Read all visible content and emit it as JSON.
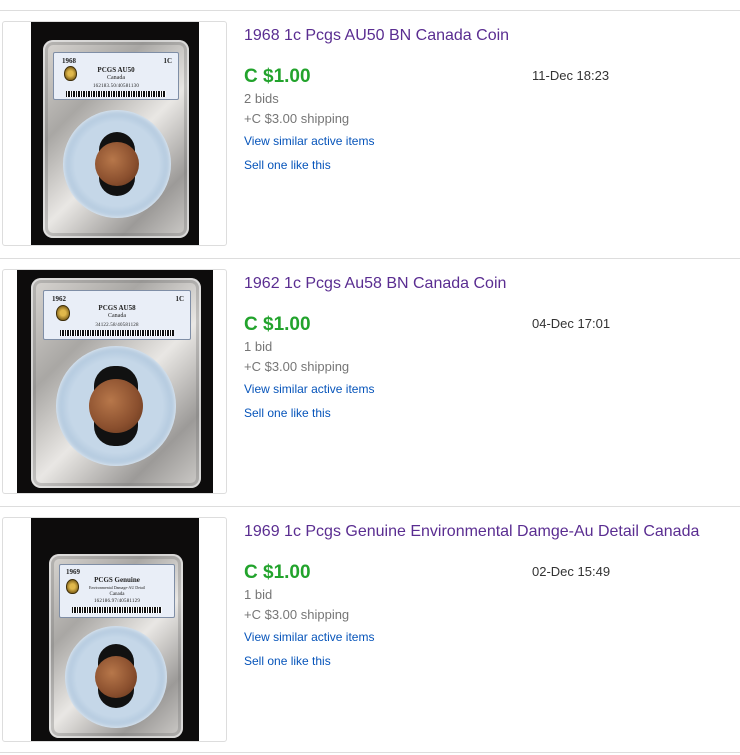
{
  "listings": [
    {
      "title": "1968 1c Pcgs AU50 BN Canada Coin",
      "price": "C $1.00",
      "bids": "2 bids",
      "shipping": "+C $3.00 shipping",
      "end_time": "11-Dec 18:23",
      "link_similar": "View similar active items",
      "link_sell": "Sell one like this",
      "label": {
        "year": "1968",
        "grade": "PCGS AU50",
        "country": "Canada",
        "denom": "1C",
        "cert": "162183.50/40581130"
      }
    },
    {
      "title": "1962 1c Pcgs Au58 BN Canada Coin",
      "price": "C $1.00",
      "bids": "1 bid",
      "shipping": "+C $3.00 shipping",
      "end_time": "04-Dec 17:01",
      "link_similar": "View similar active items",
      "link_sell": "Sell one like this",
      "label": {
        "year": "1962",
        "grade": "PCGS AU58",
        "country": "Canada",
        "denom": "1C",
        "cert": "34122.58/40581128"
      }
    },
    {
      "title": "1969 1c Pcgs Genuine Environmental Damge-Au Detail Canada",
      "price": "C $1.00",
      "bids": "1 bid",
      "shipping": "+C $3.00 shipping",
      "end_time": "02-Dec 15:49",
      "link_similar": "View similar active items",
      "link_sell": "Sell one like this",
      "label": {
        "year": "1969",
        "grade": "PCGS Genuine",
        "country": "Canada",
        "denom": "",
        "cert": "162186.97/40581129",
        "note": "Environmental Damage-AU Detail"
      }
    }
  ],
  "colors": {
    "title": "#5a2d91",
    "price": "#22a32c",
    "link": "#0654ba",
    "muted": "#767676",
    "divider": "#dddddd"
  }
}
